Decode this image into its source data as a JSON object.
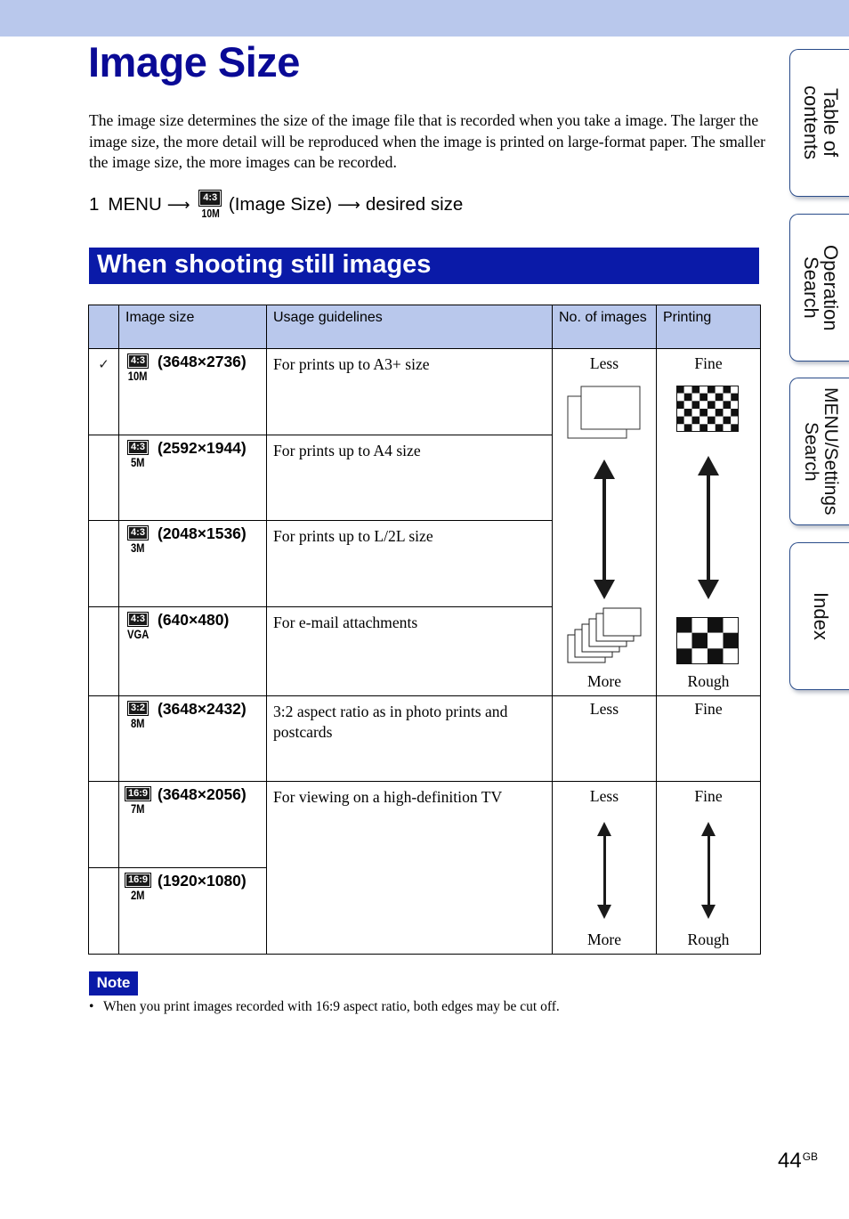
{
  "header": {
    "band_color": "#b9c8ec"
  },
  "page_title": "Image Size",
  "intro_text": "The image size determines the size of the image file that is recorded when you take a image. The larger the image size, the more detail will be reproduced when the image is printed on large-format paper. The smaller the image size, the more images can be recorded.",
  "step": {
    "number": "1",
    "menu": "MENU",
    "arrow": "⟶",
    "icon_ratio": "4:3",
    "icon_mp": "10M",
    "item": "(Image Size)",
    "target": "desired size"
  },
  "section_title": "When shooting still images",
  "table": {
    "headers": [
      "",
      "Image size",
      "Usage guidelines",
      "No. of images",
      "Printing"
    ],
    "rows": [
      {
        "checked": true,
        "ratio": "4:3",
        "mp": "10M",
        "dims": "(3648×2736)",
        "usage": "For prints up to A3+ size"
      },
      {
        "checked": false,
        "ratio": "4:3",
        "mp": "5M",
        "dims": "(2592×1944)",
        "usage": "For prints up to A4 size"
      },
      {
        "checked": false,
        "ratio": "4:3",
        "mp": "3M",
        "dims": "(2048×1536)",
        "usage": "For prints up to L/2L size"
      },
      {
        "checked": false,
        "ratio": "4:3",
        "mp": "VGA",
        "dims": "(640×480)",
        "usage": "For e-mail attachments"
      },
      {
        "checked": false,
        "ratio": "3:2",
        "mp": "8M",
        "dims": "(3648×2432)",
        "usage": "3:2 aspect ratio as in photo prints and postcards",
        "images": "Less",
        "printing": "Fine"
      },
      {
        "checked": false,
        "ratio": "16:9",
        "mp": "7M",
        "dims": "(3648×2056)",
        "usage": "For viewing on a high-definition TV"
      },
      {
        "checked": false,
        "ratio": "16:9",
        "mp": "2M",
        "dims": "(1920×1080)"
      }
    ],
    "scale_43": {
      "images_top": "Less",
      "images_bottom": "More",
      "printing_top": "Fine",
      "printing_bottom": "Rough"
    },
    "scale_169": {
      "images_top": "Less",
      "images_bottom": "More",
      "printing_top": "Fine",
      "printing_bottom": "Rough"
    },
    "check_icon": "✓"
  },
  "note": {
    "label": "Note",
    "bullet": "•",
    "text": "When you print images recorded with 16:9 aspect ratio, both edges may be cut off."
  },
  "side_tabs": [
    {
      "label": "Table of\ncontents"
    },
    {
      "label": "Operation\nSearch"
    },
    {
      "label": "MENU/Settings\nSearch"
    },
    {
      "label": "Index"
    }
  ],
  "page_number": {
    "number": "44",
    "suffix": "GB"
  }
}
